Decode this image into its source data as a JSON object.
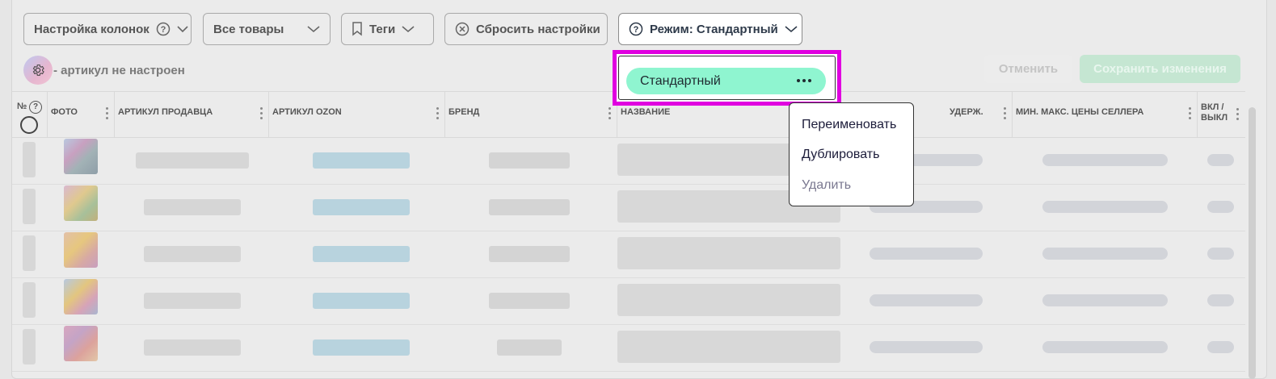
{
  "toolbar": {
    "column_settings": "Настройка колонок",
    "all_products": "Все товары",
    "tags": "Теги",
    "reset_settings": "Сбросить настройки",
    "mode": "Режим: Стандартный"
  },
  "sku_status": "- артикул не настроен",
  "actions": {
    "cancel": "Отменить",
    "save": "Сохранить изменения"
  },
  "table": {
    "columns": [
      "№",
      "ФОТО",
      "АРТИКУЛ ПРОДАВЦА",
      "АРТИКУЛ OZON",
      "БРЕНД",
      "НАЗВАНИЕ",
      "УДЕРЖ.",
      "МИН. МАКС. ЦЕНЫ СЕЛЛЕРА",
      "ВКЛ / ВЫКЛ"
    ]
  },
  "mode_dropdown": {
    "selected": "Стандартный"
  },
  "context_menu": {
    "items": [
      {
        "label": "Переименовать",
        "disabled": false
      },
      {
        "label": "Дублировать",
        "disabled": false
      },
      {
        "label": "Удалить",
        "disabled": true
      }
    ]
  },
  "colors": {
    "mode_highlight": "#8ff5d0",
    "focus_outline": "#e000e0",
    "save_button": "#c5e6d2"
  }
}
